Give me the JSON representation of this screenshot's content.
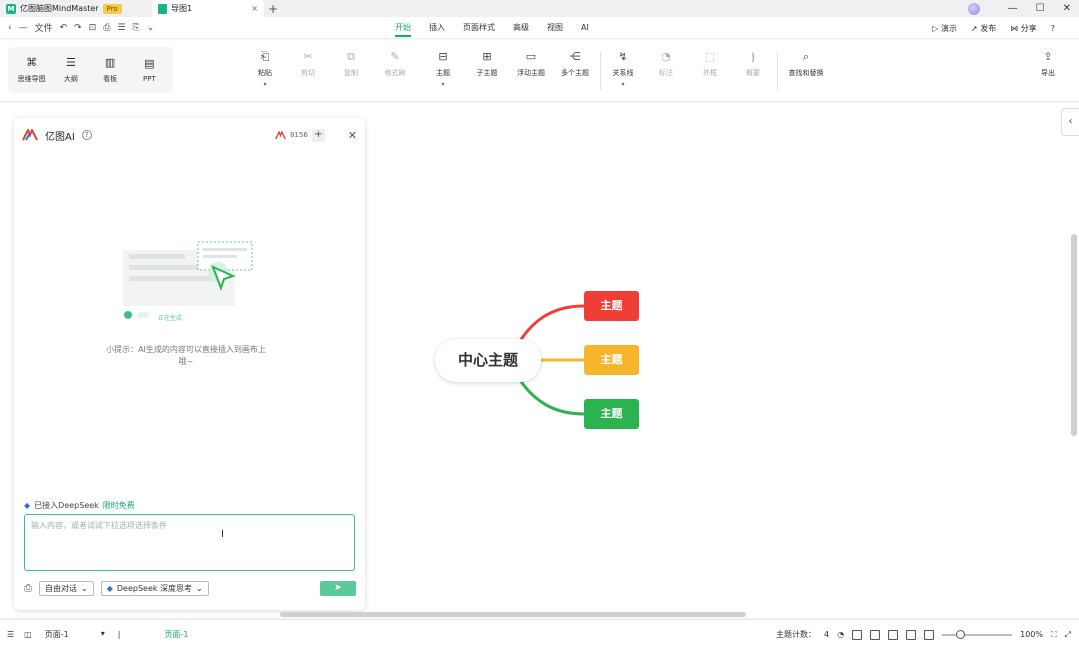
{
  "titlebar": {
    "app_title": "亿图脑图MindMaster",
    "pro_badge": "Pro",
    "doc_tab": "导图1",
    "close_glyph": "×",
    "new_tab_glyph": "+",
    "window_controls": [
      "—",
      "☐",
      "✕"
    ]
  },
  "menubar": {
    "quick": [
      "‹",
      "—",
      "文件",
      "↶",
      "↷",
      "⊡",
      "⎙",
      "☰",
      "⎘",
      "⌄"
    ],
    "tabs": [
      {
        "label": "开始",
        "active": true
      },
      {
        "label": "插入",
        "active": false
      },
      {
        "label": "页面样式",
        "active": false
      },
      {
        "label": "高级",
        "active": false
      },
      {
        "label": "视图",
        "active": false
      },
      {
        "label": "AI",
        "active": false
      }
    ],
    "right": {
      "record": "演示",
      "publish": "发布",
      "share": "分享",
      "help": "?"
    }
  },
  "ribbon": {
    "views": [
      {
        "label": "思维导图",
        "icon": "mindmap-icon",
        "glyph": "⌘"
      },
      {
        "label": "大纲",
        "icon": "outline-icon",
        "glyph": "☰"
      },
      {
        "label": "看板",
        "icon": "kanban-icon",
        "glyph": "▥"
      },
      {
        "label": "PPT",
        "icon": "ppt-icon",
        "glyph": "▤"
      }
    ],
    "tools": [
      {
        "label": "粘贴",
        "icon": "paste-icon",
        "glyph": "📋",
        "dropdown": true,
        "dim": false
      },
      {
        "label": "剪切",
        "icon": "cut-icon",
        "glyph": "✂",
        "dropdown": false,
        "dim": true
      },
      {
        "label": "复制",
        "icon": "copy-icon",
        "glyph": "⧉",
        "dropdown": false,
        "dim": true
      },
      {
        "label": "格式刷",
        "icon": "format-painter-icon",
        "glyph": "🖌",
        "dropdown": false,
        "dim": true
      },
      {
        "label": "主题",
        "icon": "topic-icon",
        "glyph": "⊟",
        "dropdown": true,
        "dim": false
      },
      {
        "label": "子主题",
        "icon": "subtopic-icon",
        "glyph": "⊞",
        "dropdown": false,
        "dim": false
      },
      {
        "label": "浮动主题",
        "icon": "floating-topic-icon",
        "glyph": "▭",
        "dropdown": false,
        "dim": false
      },
      {
        "label": "多个主题",
        "icon": "multiple-topics-icon",
        "glyph": "⋲",
        "dropdown": false,
        "dim": false
      },
      {
        "label": "关系线",
        "icon": "relationship-icon",
        "glyph": "↯",
        "dropdown": true,
        "dim": false
      },
      {
        "label": "标注",
        "icon": "callout-icon",
        "glyph": "💬",
        "dropdown": false,
        "dim": true
      },
      {
        "label": "外框",
        "icon": "boundary-icon",
        "glyph": "⬚",
        "dropdown": false,
        "dim": true
      },
      {
        "label": "概要",
        "icon": "summary-icon",
        "glyph": "⦘",
        "dropdown": false,
        "dim": true
      },
      {
        "label": "查找和替换",
        "icon": "find-replace-icon",
        "glyph": "🔍",
        "dropdown": false,
        "dim": false
      },
      {
        "label": "导出",
        "icon": "export-icon",
        "glyph": "⇪",
        "dropdown": false,
        "dim": false
      }
    ]
  },
  "ai_panel": {
    "title": "亿图AI",
    "credits": "8156",
    "illustration_caption": "正在生成",
    "hint": "小提示：AI生成的内容可以直接插入到画布上哦~",
    "deepseek_text": "已接入DeepSeek",
    "deepseek_link": "限时免费",
    "input_placeholder": "输入内容，或者试试下拉选项选择条件",
    "mode_select": "自由对话",
    "model_select": "DeepSeek 深度思考",
    "send_glyph": "➤"
  },
  "mindmap": {
    "center": "中心主题",
    "topics": [
      {
        "label": "主题",
        "color": "#ef3e36"
      },
      {
        "label": "主题",
        "color": "#f7b52b"
      },
      {
        "label": "主题",
        "color": "#2ab34e"
      }
    ]
  },
  "statusbar": {
    "page_select": "页面-1",
    "current_page": "页面-1",
    "topic_count_label": "主题计数：",
    "topic_count": "4",
    "zoom": "100%"
  }
}
